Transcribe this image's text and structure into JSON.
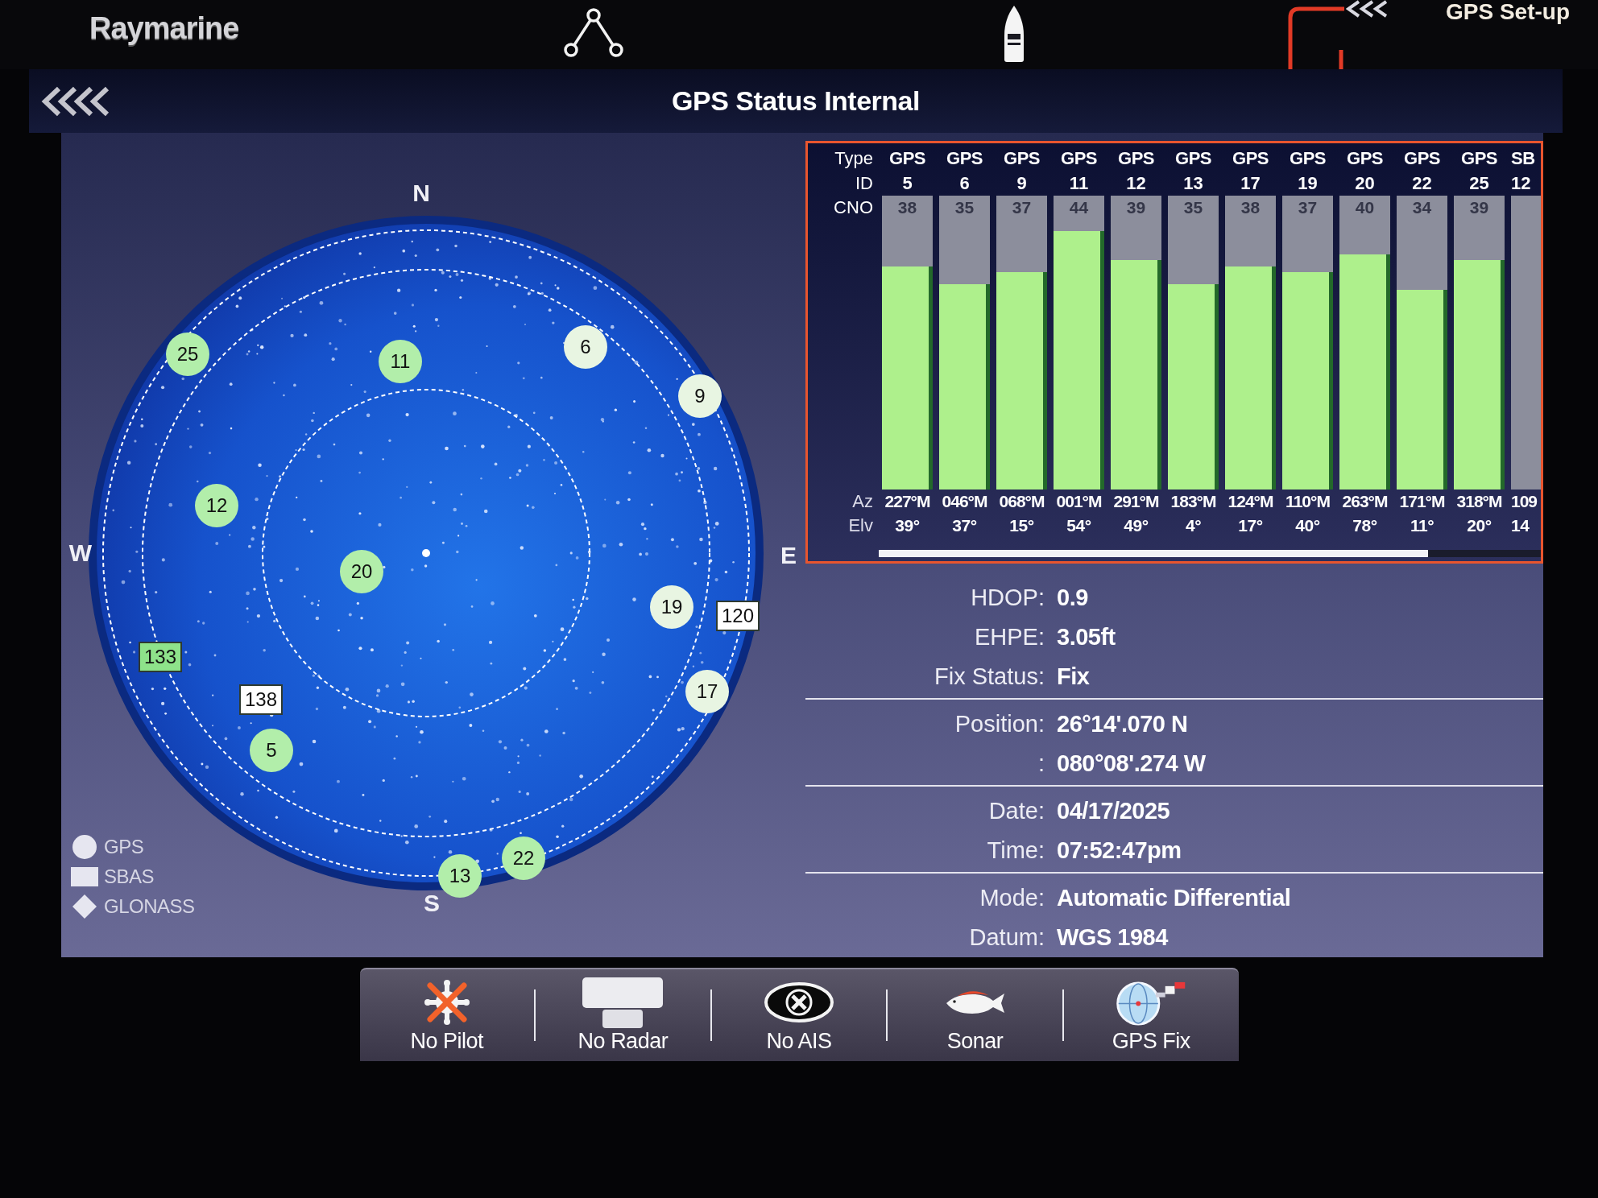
{
  "top_bar": {
    "logo": "Raymarine",
    "setup_tab": {
      "label": "GPS Set-up"
    }
  },
  "title": "GPS Status Internal",
  "sky_plot": {
    "compass": {
      "north": "N",
      "east": "E",
      "south": "S",
      "west": "W"
    },
    "satellites": [
      {
        "label": "6",
        "kind": "gps",
        "color": "#e8f5e2"
      },
      {
        "label": "25",
        "kind": "gps",
        "color": "#b2eeaa"
      },
      {
        "label": "11",
        "kind": "gps",
        "color": "#b2eeaa"
      },
      {
        "label": "9",
        "kind": "gps",
        "color": "#e8f5e2"
      },
      {
        "label": "12",
        "kind": "gps",
        "color": "#b2eeaa"
      },
      {
        "label": "20",
        "kind": "gps",
        "color": "#b2eeaa"
      },
      {
        "label": "19",
        "kind": "gps",
        "color": "#e8f5e2"
      },
      {
        "label": "120",
        "kind": "sbas",
        "color": "#ffffff"
      },
      {
        "label": "133",
        "kind": "sbas",
        "color": "#8ee28a"
      },
      {
        "label": "17",
        "kind": "gps",
        "color": "#e8f5e2"
      },
      {
        "label": "138",
        "kind": "sbas",
        "color": "#ffffff"
      },
      {
        "label": "5",
        "kind": "gps",
        "color": "#b2eeaa"
      },
      {
        "label": "22",
        "kind": "gps",
        "color": "#b2eeaa"
      },
      {
        "label": "13",
        "kind": "gps",
        "color": "#b2eeaa"
      }
    ],
    "legend": [
      {
        "kind": "gps",
        "label": "GPS"
      },
      {
        "kind": "sbas",
        "label": "SBAS"
      },
      {
        "kind": "glonass",
        "label": "GLONASS"
      }
    ]
  },
  "signal_table": {
    "row_labels": {
      "type": "Type",
      "id": "ID",
      "cno": "CNO",
      "az": "Az",
      "elv": "Elv"
    },
    "satellites": [
      {
        "type": "GPS",
        "id": "5",
        "cno": "38",
        "level": 0.76,
        "az": "227°M",
        "elv": "39°"
      },
      {
        "type": "GPS",
        "id": "6",
        "cno": "35",
        "level": 0.7,
        "az": "046°M",
        "elv": "37°"
      },
      {
        "type": "GPS",
        "id": "9",
        "cno": "37",
        "level": 0.74,
        "az": "068°M",
        "elv": "15°"
      },
      {
        "type": "GPS",
        "id": "11",
        "cno": "44",
        "level": 0.88,
        "az": "001°M",
        "elv": "54°"
      },
      {
        "type": "GPS",
        "id": "12",
        "cno": "39",
        "level": 0.78,
        "az": "291°M",
        "elv": "49°"
      },
      {
        "type": "GPS",
        "id": "13",
        "cno": "35",
        "level": 0.7,
        "az": "183°M",
        "elv": "4°"
      },
      {
        "type": "GPS",
        "id": "17",
        "cno": "38",
        "level": 0.76,
        "az": "124°M",
        "elv": "17°"
      },
      {
        "type": "GPS",
        "id": "19",
        "cno": "37",
        "level": 0.74,
        "az": "110°M",
        "elv": "40°"
      },
      {
        "type": "GPS",
        "id": "20",
        "cno": "40",
        "level": 0.8,
        "az": "263°M",
        "elv": "78°"
      },
      {
        "type": "GPS",
        "id": "22",
        "cno": "34",
        "level": 0.68,
        "az": "171°M",
        "elv": "11°"
      },
      {
        "type": "GPS",
        "id": "25",
        "cno": "39",
        "level": 0.78,
        "az": "318°M",
        "elv": "20°"
      },
      {
        "type": "SB",
        "id": "12",
        "level": 0,
        "az": "109",
        "elv": "14"
      }
    ]
  },
  "info": {
    "sections": [
      {
        "rows": [
          {
            "label": "HDOP:",
            "value": "0.9"
          },
          {
            "label": "EHPE:",
            "value": "3.05ft"
          },
          {
            "label": "Fix Status:",
            "value": "Fix"
          }
        ]
      },
      {
        "rows": [
          {
            "label": "Position:",
            "value": "26°14'.070 N"
          },
          {
            "label": ":",
            "value": "080°08'.274 W"
          }
        ]
      },
      {
        "rows": [
          {
            "label": "Date:",
            "value": "04/17/2025"
          },
          {
            "label": "Time:",
            "value": "07:52:47pm"
          }
        ]
      },
      {
        "rows": [
          {
            "label": "Mode:",
            "value": "Automatic Differential"
          },
          {
            "label": "Datum:",
            "value": "WGS 1984"
          }
        ]
      }
    ]
  },
  "bottom_bar": {
    "buttons": [
      {
        "kind": "pilot",
        "label": "No Pilot"
      },
      {
        "kind": "radar",
        "label": "No Radar"
      },
      {
        "kind": "ais",
        "label": "No AIS"
      },
      {
        "kind": "sonar",
        "label": "Sonar"
      },
      {
        "kind": "gps",
        "label": "GPS Fix"
      }
    ]
  }
}
